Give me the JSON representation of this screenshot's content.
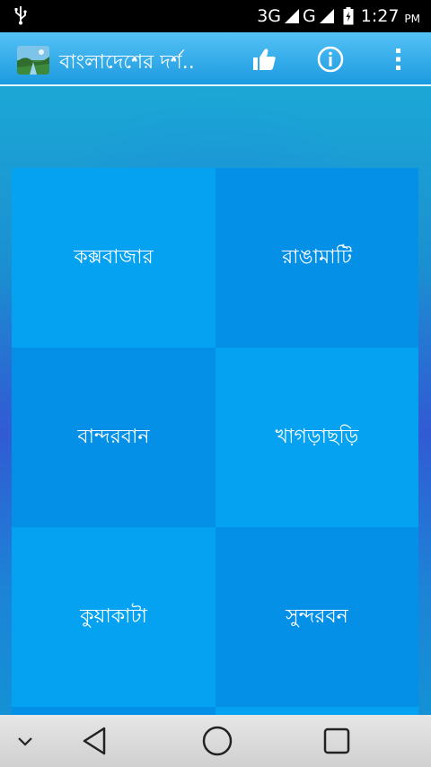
{
  "status_bar": {
    "network_3g": "3G",
    "network_g": "G",
    "time": "1:27",
    "ampm": "PM",
    "icons": [
      "usb-icon",
      "signal-icon",
      "signal-icon",
      "battery-charging-icon"
    ]
  },
  "action_bar": {
    "title": "বাংলাদেশের দর্শ..",
    "icons": [
      "app-logo",
      "like-icon",
      "info-icon",
      "overflow-menu-icon"
    ]
  },
  "grid": {
    "tiles": [
      {
        "label": "কক্সবাজার",
        "shade": "light"
      },
      {
        "label": "রাঙামাটি",
        "shade": "dark"
      },
      {
        "label": "বান্দরবান",
        "shade": "dark"
      },
      {
        "label": "খাগড়াছড়ি",
        "shade": "light"
      },
      {
        "label": "কুয়াকাটা",
        "shade": "light"
      },
      {
        "label": "সুন্দরবন",
        "shade": "dark"
      }
    ]
  },
  "nav_bar": {
    "icons": [
      "chevron-down-icon",
      "back-icon",
      "home-icon",
      "recents-icon"
    ]
  },
  "colors": {
    "action_bar": "#1c9ae0",
    "tile_light": "#05a2f2",
    "tile_dark": "#0590e8",
    "background": "#1b8fd0"
  }
}
